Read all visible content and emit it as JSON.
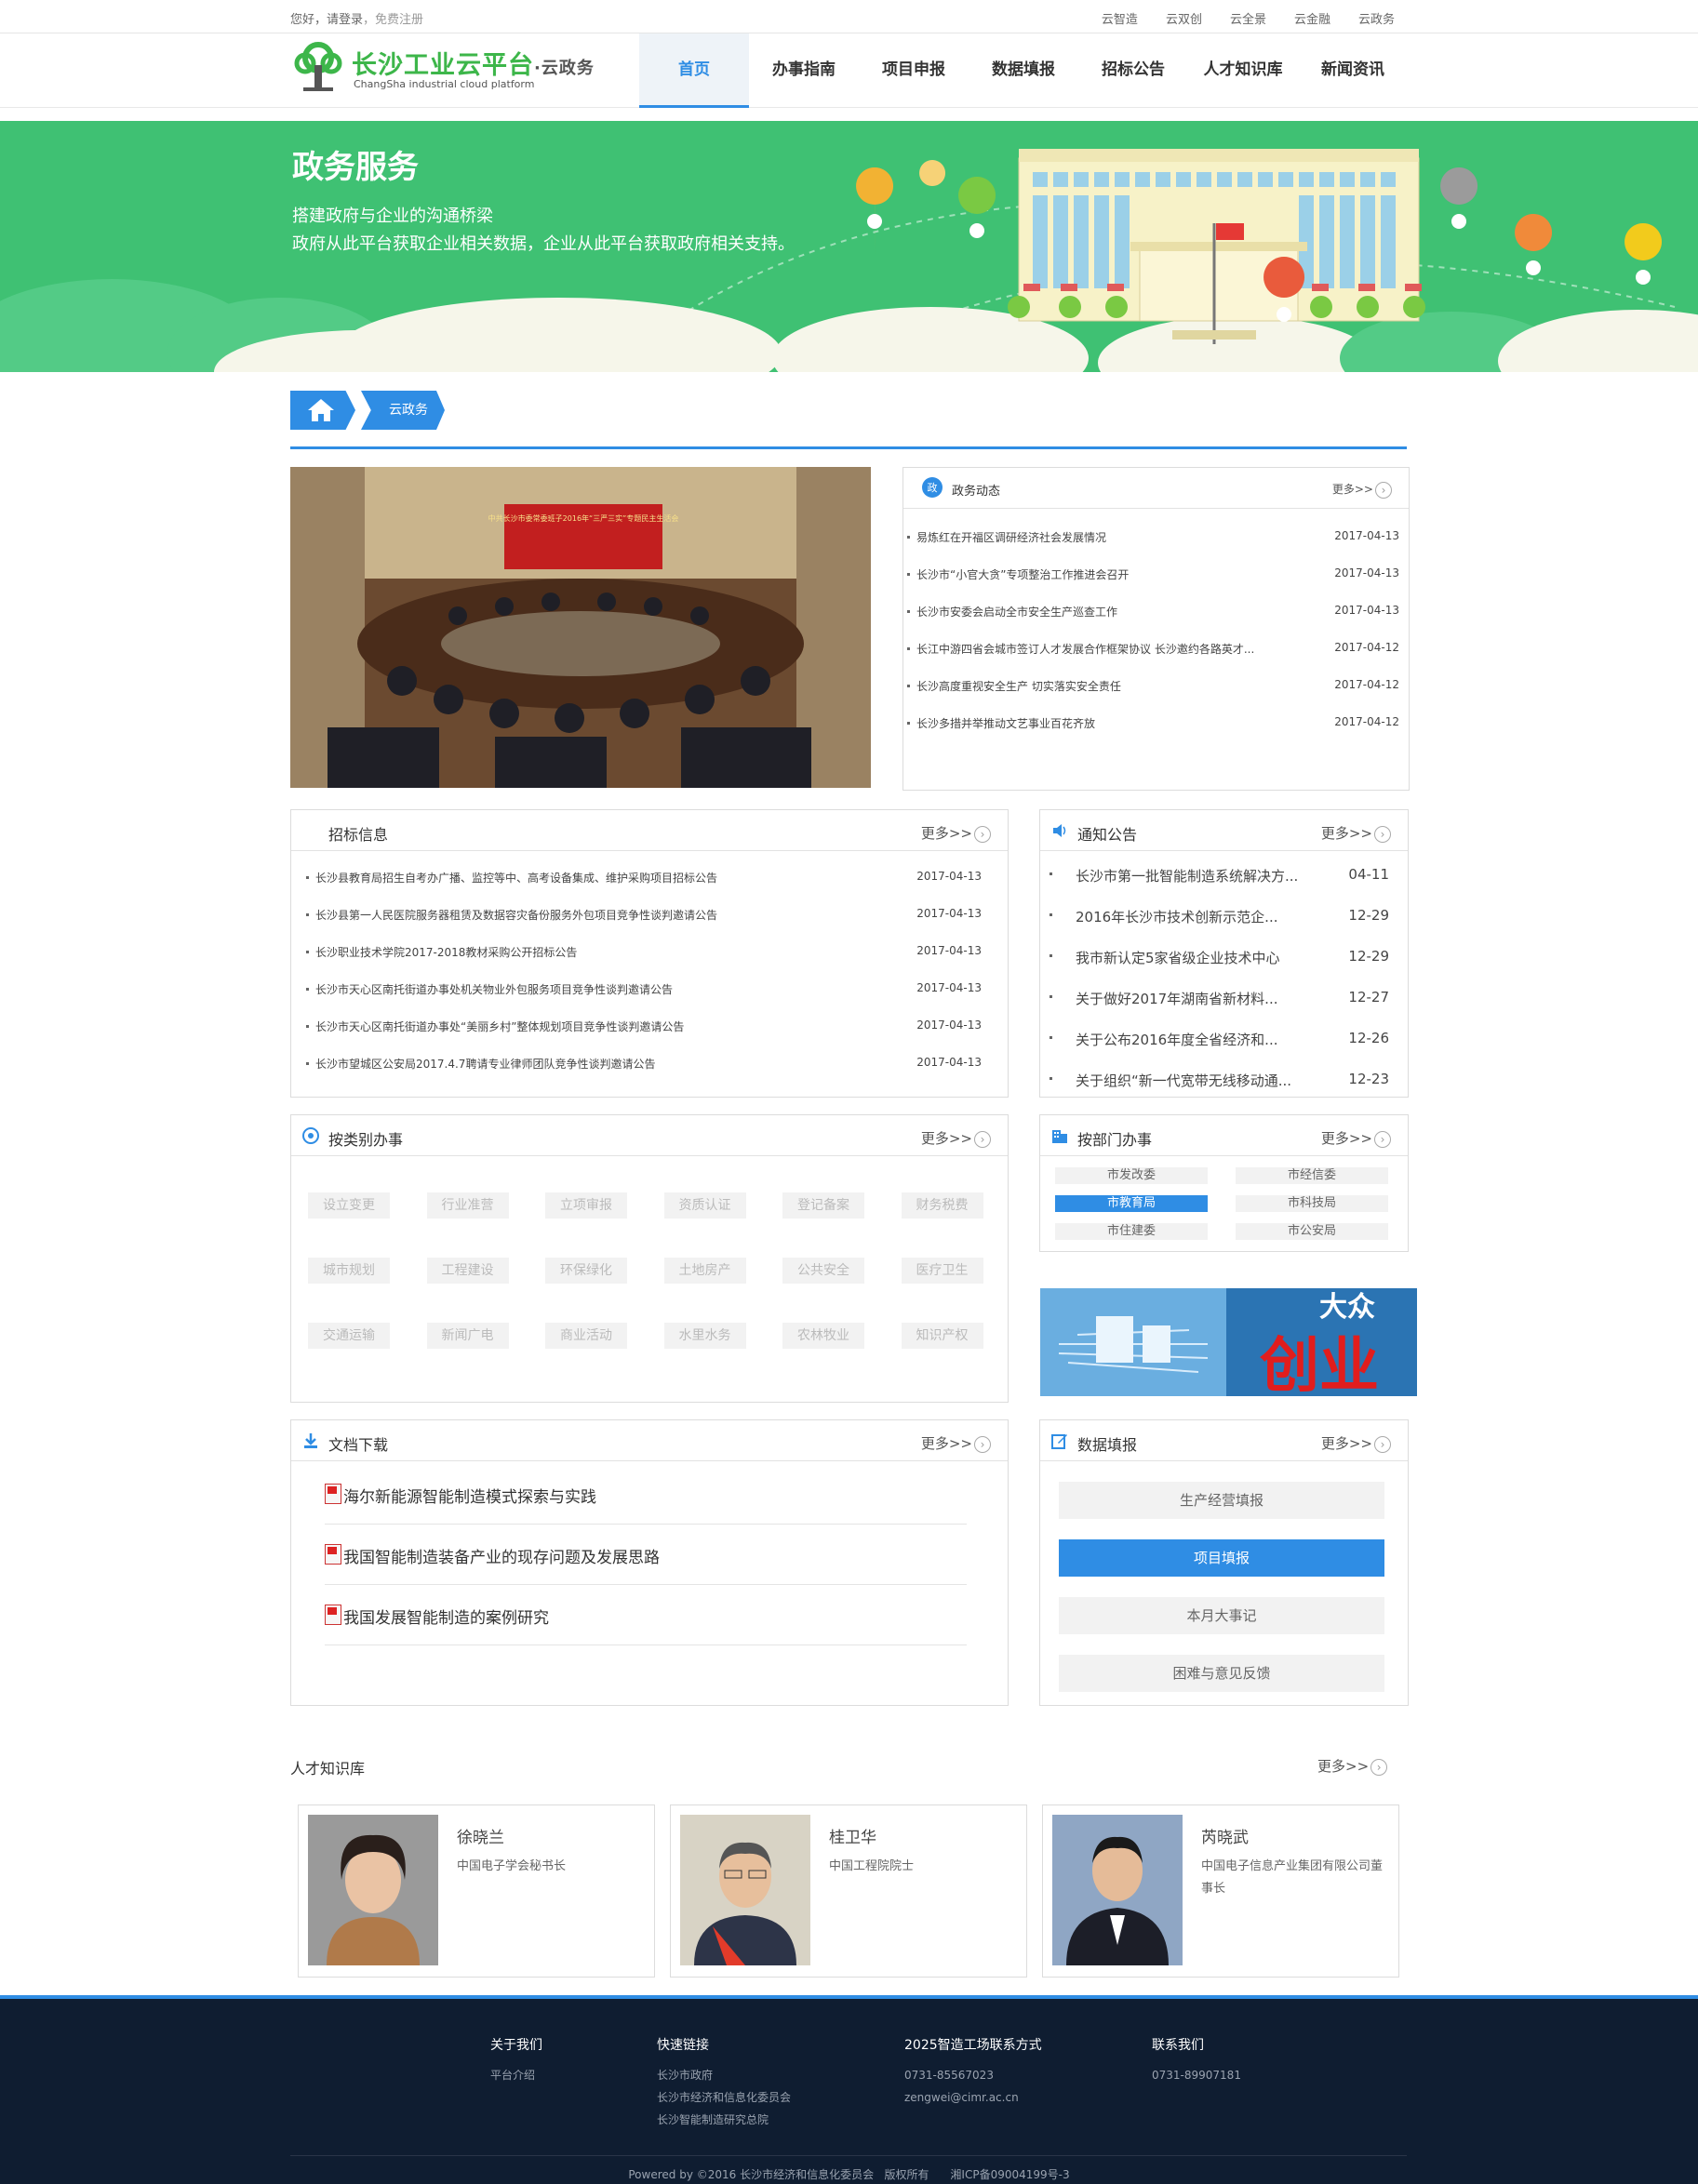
{
  "topbar": {
    "greeting": "您好，请登录",
    "register": "，免费注册",
    "links": [
      "云智造",
      "云双创",
      "云全景",
      "云金融",
      "云政务"
    ]
  },
  "logo": {
    "title": "长沙工业云平台",
    "suffix": "·云政务",
    "subtitle": "ChangSha industrial cloud platform"
  },
  "nav": [
    "首页",
    "办事指南",
    "项目申报",
    "数据填报",
    "招标公告",
    "人才知识库",
    "新闻资讯"
  ],
  "banner": {
    "title": "政务服务",
    "line1": "搭建政府与企业的沟通桥梁",
    "line2": "政府从此平台获取企业相关数据，企业从此平台获取政府相关支持。"
  },
  "breadcrumb": {
    "current": "云政务"
  },
  "photo": {
    "sign_text": "中共长沙市委常委班子2016年“三严三实”专题民主生活会"
  },
  "gov_news": {
    "title": "政务动态",
    "more": "更多>>",
    "items": [
      {
        "title": "易炼红在开福区调研经济社会发展情况",
        "date": "2017-04-13"
      },
      {
        "title": "长沙市“小官大贪”专项整治工作推进会召开",
        "date": "2017-04-13"
      },
      {
        "title": "长沙市安委会启动全市安全生产巡查工作",
        "date": "2017-04-13"
      },
      {
        "title": "长江中游四省会城市签订人才发展合作框架协议 长沙邀约各路英才...",
        "date": "2017-04-12"
      },
      {
        "title": "长沙高度重视安全生产 切实落实安全责任",
        "date": "2017-04-12"
      },
      {
        "title": "长沙多措并举推动文艺事业百花齐放",
        "date": "2017-04-12"
      }
    ]
  },
  "bidding": {
    "title": "招标信息",
    "more": "更多>>",
    "items": [
      {
        "title": "长沙县教育局招生自考办广播、监控等中、高考设备集成、维护采购项目招标公告",
        "date": "2017-04-13"
      },
      {
        "title": "长沙县第一人民医院服务器租赁及数据容灾备份服务外包项目竞争性谈判邀请公告",
        "date": "2017-04-13"
      },
      {
        "title": "长沙职业技术学院2017-2018教材采购公开招标公告",
        "date": "2017-04-13"
      },
      {
        "title": "长沙市天心区南托街道办事处机关物业外包服务项目竞争性谈判邀请公告",
        "date": "2017-04-13"
      },
      {
        "title": "长沙市天心区南托街道办事处“美丽乡村”整体规划项目竞争性谈判邀请公告",
        "date": "2017-04-13"
      },
      {
        "title": "长沙市望城区公安局2017.4.7聘请专业律师团队竞争性谈判邀请公告",
        "date": "2017-04-13"
      }
    ]
  },
  "notices": {
    "title": "通知公告",
    "more": "更多>>",
    "items": [
      {
        "title": "长沙市第一批智能制造系统解决方...",
        "date": "04-11"
      },
      {
        "title": "2016年长沙市技术创新示范企...",
        "date": "12-29"
      },
      {
        "title": "我市新认定5家省级企业技术中心",
        "date": "12-29"
      },
      {
        "title": "关于做好2017年湖南省新材料...",
        "date": "12-27"
      },
      {
        "title": "关于公布2016年度全省经济和...",
        "date": "12-26"
      },
      {
        "title": "关于组织“新一代宽带无线移动通...",
        "date": "12-23"
      }
    ]
  },
  "category": {
    "title": "按类别办事",
    "more": "更多>>",
    "tags": [
      "设立变更",
      "行业准营",
      "立项审报",
      "资质认证",
      "登记备案",
      "财务税费",
      "城市规划",
      "工程建设",
      "环保绿化",
      "土地房产",
      "公共安全",
      "医疗卫生",
      "交通运输",
      "新闻广电",
      "商业活动",
      "水里水务",
      "农林牧业",
      "知识产权"
    ]
  },
  "department": {
    "title": "按部门办事",
    "more": "更多>>",
    "tags": [
      "市发改委",
      "市经信委",
      "市教育局",
      "市科技局",
      "市住建委",
      "市公安局"
    ],
    "active": "市教育局"
  },
  "promo": {
    "text1": "大众",
    "text2": "创业"
  },
  "docs": {
    "title": "文档下载",
    "more": "更多>>",
    "items": [
      "海尔新能源智能制造模式探索与实践",
      "我国智能制造装备产业的现存问题及发展思路",
      "我国发展智能制造的案例研究"
    ]
  },
  "datafill": {
    "title": "数据填报",
    "more": "更多>>",
    "buttons": [
      "生产经营填报",
      "项目填报",
      "本月大事记",
      "困难与意见反馈"
    ],
    "active": "项目填报"
  },
  "talents": {
    "title": "人才知识库",
    "more": "更多>>",
    "people": [
      {
        "name": "徐晓兰",
        "desc": "中国电子学会秘书长"
      },
      {
        "name": "桂卫华",
        "desc": "中国工程院院士"
      },
      {
        "name": "芮晓武",
        "desc": "中国电子信息产业集团有限公司董事长"
      }
    ]
  },
  "footer": {
    "about": {
      "title": "关于我们",
      "links": [
        "平台介绍"
      ]
    },
    "quick": {
      "title": "快速链接",
      "links": [
        "长沙市政府",
        "长沙市经济和信息化委员会",
        "长沙智能制造研究总院"
      ]
    },
    "contact1": {
      "title": "2025智造工场联系方式",
      "lines": [
        "0731-85567023",
        "zengwei@cimr.ac.cn"
      ]
    },
    "contact2": {
      "title": "联系我们",
      "lines": [
        "0731-89907181"
      ]
    },
    "copyright": "Powered by ©2016 长沙市经济和信息化委员会   版权所有      湘ICP备09004199号-3"
  },
  "colors": {
    "brand_blue": "#2f8de4",
    "banner_green": "#3fc173",
    "logo_green": "#3db64a",
    "footer_bg": "#0f1d31"
  }
}
